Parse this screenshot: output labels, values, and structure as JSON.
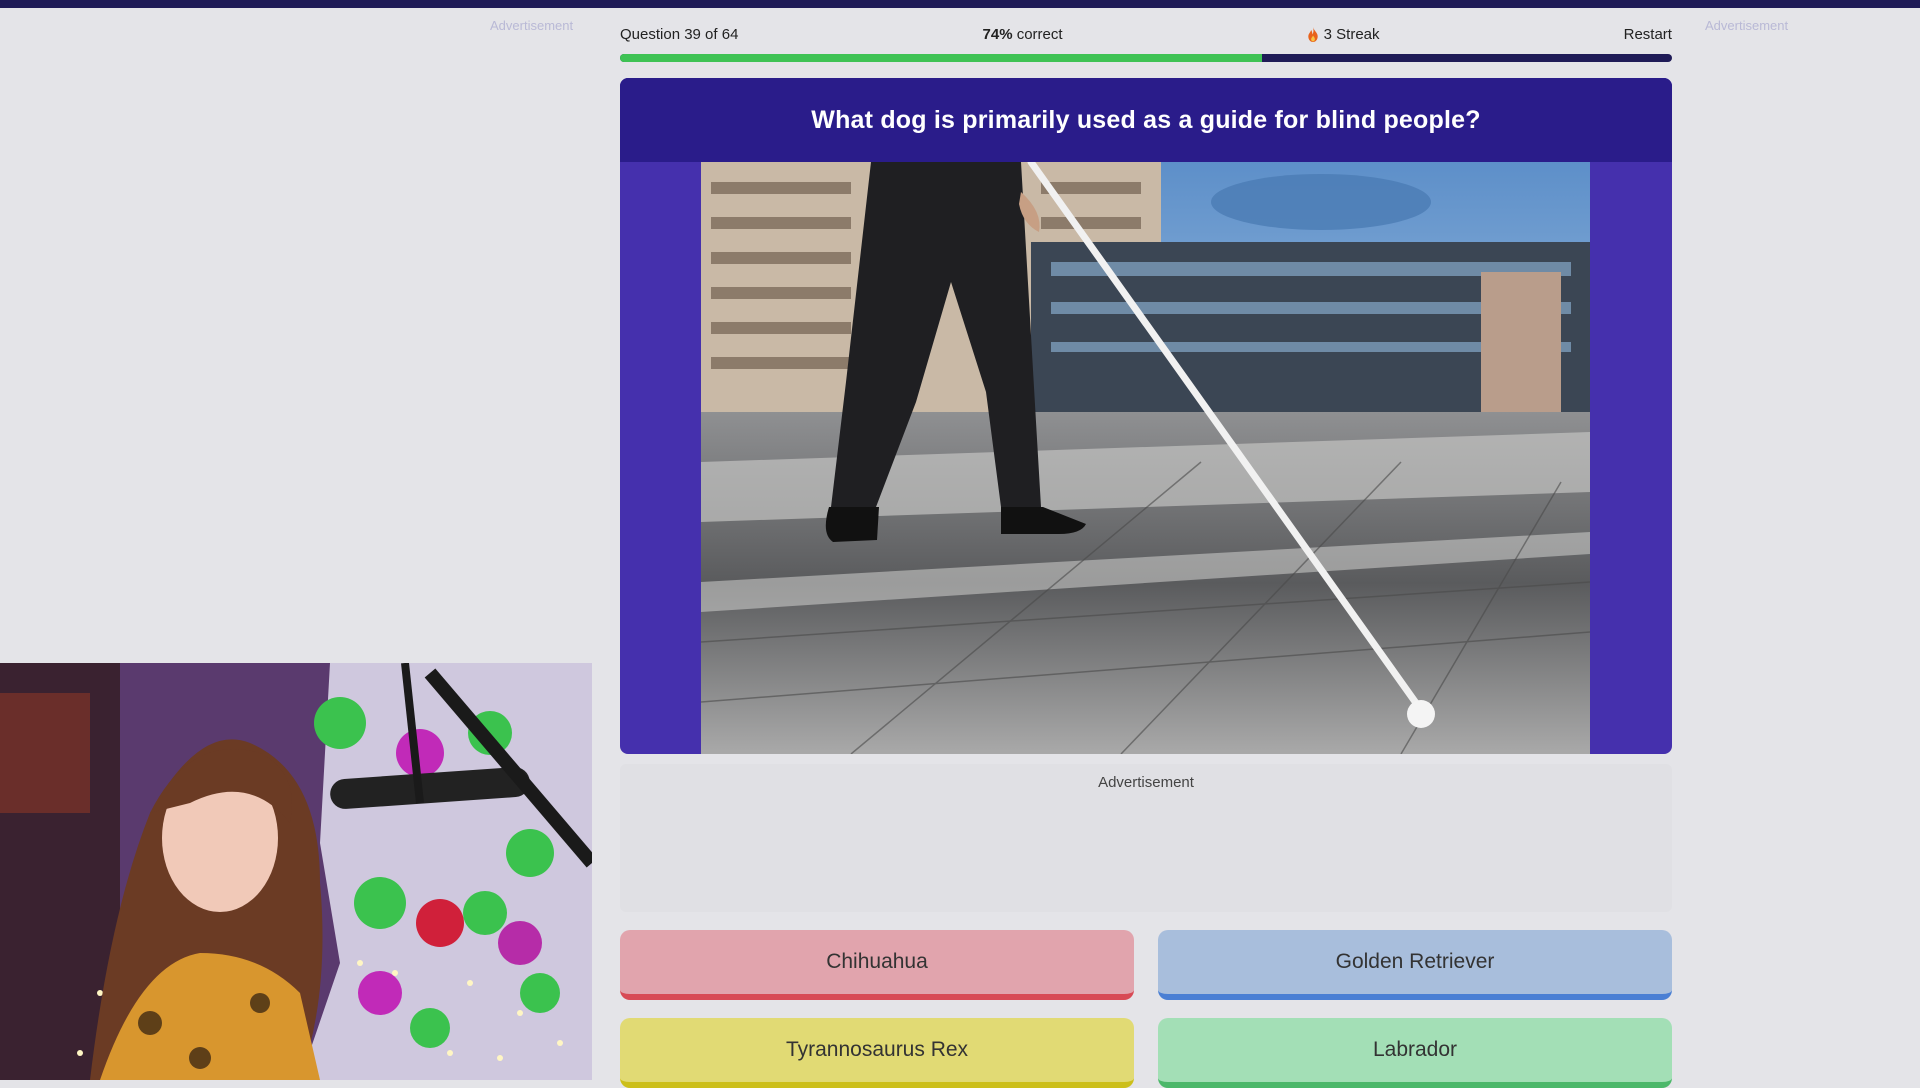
{
  "ads": {
    "left_label": "Advertisement",
    "right_label": "Advertisement",
    "center_label": "Advertisement"
  },
  "status": {
    "question_progress": "Question 39 of 64",
    "correct_pct": "74%",
    "correct_suffix": " correct",
    "streak": "3 Streak",
    "restart": "Restart"
  },
  "progress_fraction": 0.61,
  "question": "What dog is primarily used as a guide for blind people?",
  "answers": [
    {
      "label": "Chihuahua",
      "color": "red"
    },
    {
      "label": "Golden Retriever",
      "color": "blue"
    },
    {
      "label": "Tyrannosaurus Rex",
      "color": "yellow"
    },
    {
      "label": "Labrador",
      "color": "green"
    }
  ],
  "colors": {
    "accent_navy": "#1f1b57",
    "card_purple": "#4530ad",
    "progress_green": "#3ec254"
  },
  "icons": {
    "streak": "flame-icon"
  }
}
